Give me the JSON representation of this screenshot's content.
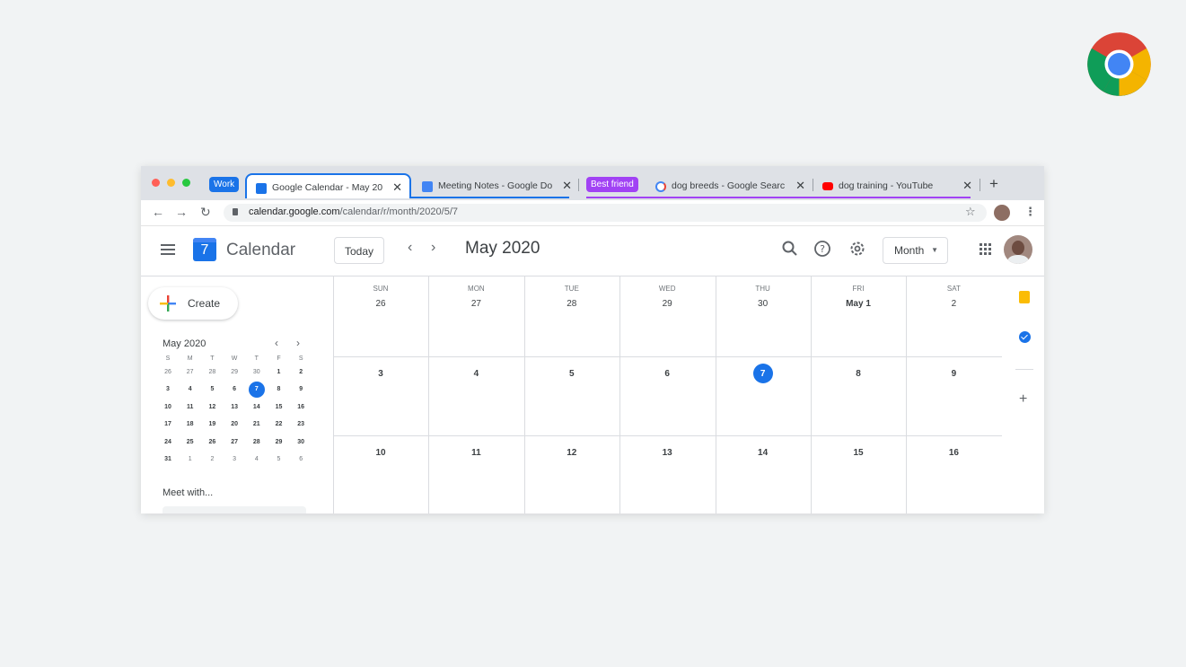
{
  "colors": {
    "accent": "#1a73e8",
    "work_group": "#1a73e8",
    "best_friend_group": "#a142f4"
  },
  "tabs": {
    "work_group_label": "Work",
    "best_friend_group_label": "Best friend",
    "items": [
      {
        "title": "Google Calendar - May 20",
        "icon": "calendar-icon"
      },
      {
        "title": "Meeting Notes - Google Do",
        "icon": "docs-icon"
      },
      {
        "title": "dog breeds - Google Searc",
        "icon": "google-icon"
      },
      {
        "title": "dog training - YouTube",
        "icon": "youtube-icon"
      }
    ],
    "close_glyph": "✕",
    "new_tab_glyph": "+"
  },
  "address_bar": {
    "url_domain": "calendar.google.com",
    "url_path": "/calendar/r/month/2020/5/7"
  },
  "calendar": {
    "app_name": "Calendar",
    "logo_number": "7",
    "today_label": "Today",
    "month_title": "May 2020",
    "view_label": "Month",
    "create_label": "Create",
    "meet_with_label": "Meet with...",
    "mini": {
      "title": "May 2020",
      "dow": [
        "S",
        "M",
        "T",
        "W",
        "T",
        "F",
        "S"
      ],
      "weeks": [
        [
          "26",
          "27",
          "28",
          "29",
          "30",
          "1",
          "2"
        ],
        [
          "3",
          "4",
          "5",
          "6",
          "7",
          "8",
          "9"
        ],
        [
          "10",
          "11",
          "12",
          "13",
          "14",
          "15",
          "16"
        ],
        [
          "17",
          "18",
          "19",
          "20",
          "21",
          "22",
          "23"
        ],
        [
          "24",
          "25",
          "26",
          "27",
          "28",
          "29",
          "30"
        ],
        [
          "31",
          "1",
          "2",
          "3",
          "4",
          "5",
          "6"
        ]
      ],
      "selected": "7"
    },
    "grid": {
      "dow": [
        "SUN",
        "MON",
        "TUE",
        "WED",
        "THU",
        "FRI",
        "SAT"
      ],
      "weeks": [
        [
          "26",
          "27",
          "28",
          "29",
          "30",
          "May 1",
          "2"
        ],
        [
          "3",
          "4",
          "5",
          "6",
          "7",
          "8",
          "9"
        ],
        [
          "10",
          "11",
          "12",
          "13",
          "14",
          "15",
          "16"
        ]
      ],
      "today": "7"
    }
  }
}
